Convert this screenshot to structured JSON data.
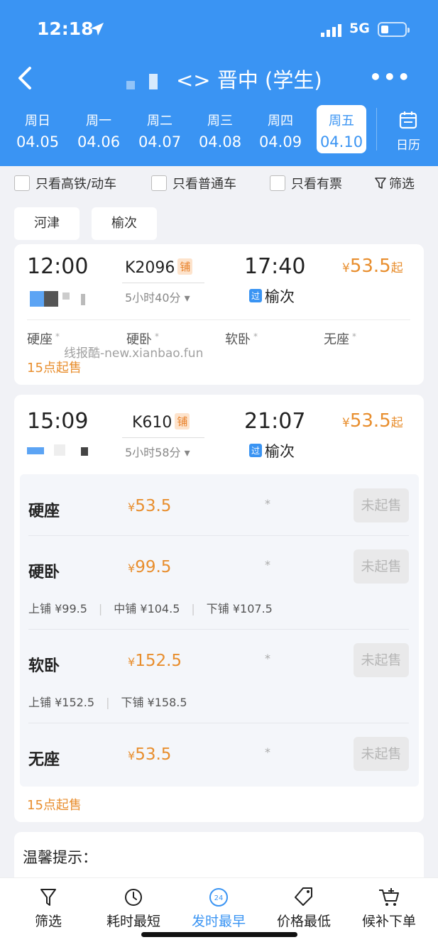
{
  "status_bar": {
    "time": "12:18",
    "network": "5G"
  },
  "header": {
    "title": "<> 晋中 (学生)",
    "more": "•••"
  },
  "dates": [
    {
      "weekday": "周日",
      "date": "04.05"
    },
    {
      "weekday": "周一",
      "date": "04.06"
    },
    {
      "weekday": "周二",
      "date": "04.07"
    },
    {
      "weekday": "周三",
      "date": "04.08"
    },
    {
      "weekday": "周四",
      "date": "04.09"
    },
    {
      "weekday": "周五",
      "date": "04.10"
    }
  ],
  "selected_date_index": 5,
  "calendar_label": "日历",
  "filters": {
    "high_speed": "只看高铁/动车",
    "regular": "只看普通车",
    "available": "只看有票",
    "filter": "筛选"
  },
  "stations": [
    "河津",
    "榆次"
  ],
  "trains": [
    {
      "depart": "12:00",
      "number": "K2096",
      "tag": "铺",
      "duration": "5小时40分",
      "arrive": "17:40",
      "price_prefix": "¥",
      "price": "53.5",
      "price_suffix": "起",
      "pass_tag": "过",
      "arrive_station": "榆次",
      "seats": [
        "硬座",
        "硬卧",
        "软卧",
        "无座"
      ],
      "seat_mark": "*",
      "sale_note": "15点起售"
    },
    {
      "depart": "15:09",
      "number": "K610",
      "tag": "铺",
      "duration": "5小时58分",
      "arrive": "21:07",
      "price_prefix": "¥",
      "price": "53.5",
      "price_suffix": "起",
      "pass_tag": "过",
      "arrive_station": "榆次",
      "seat_details": [
        {
          "name": "硬座",
          "price": "53.5",
          "mark": "*",
          "button": "未起售",
          "berths": []
        },
        {
          "name": "硬卧",
          "price": "99.5",
          "mark": "*",
          "button": "未起售",
          "berths": [
            "上铺 ¥99.5",
            "中铺 ¥104.5",
            "下铺 ¥107.5"
          ]
        },
        {
          "name": "软卧",
          "price": "152.5",
          "mark": "*",
          "button": "未起售",
          "berths": [
            "上铺 ¥152.5",
            "下铺 ¥158.5"
          ]
        },
        {
          "name": "无座",
          "price": "53.5",
          "mark": "*",
          "button": "未起售",
          "berths": []
        }
      ],
      "sale_note": "15点起售"
    }
  ],
  "watermark": "线报酷-new.xianbao.fun",
  "tips_title": "温馨提示：",
  "bottom_tabs": [
    {
      "label": "筛选",
      "icon": "filter-icon"
    },
    {
      "label": "耗时最短",
      "icon": "timer-icon"
    },
    {
      "label": "发时最早",
      "icon": "clock-24-icon",
      "badge": "24"
    },
    {
      "label": "价格最低",
      "icon": "price-tag-icon"
    },
    {
      "label": "候补下单",
      "icon": "cart-plus-icon"
    }
  ],
  "active_tab_index": 2,
  "colors": {
    "primary": "#3a94f3",
    "price": "#e88e2e",
    "background": "#f1f2f6"
  }
}
